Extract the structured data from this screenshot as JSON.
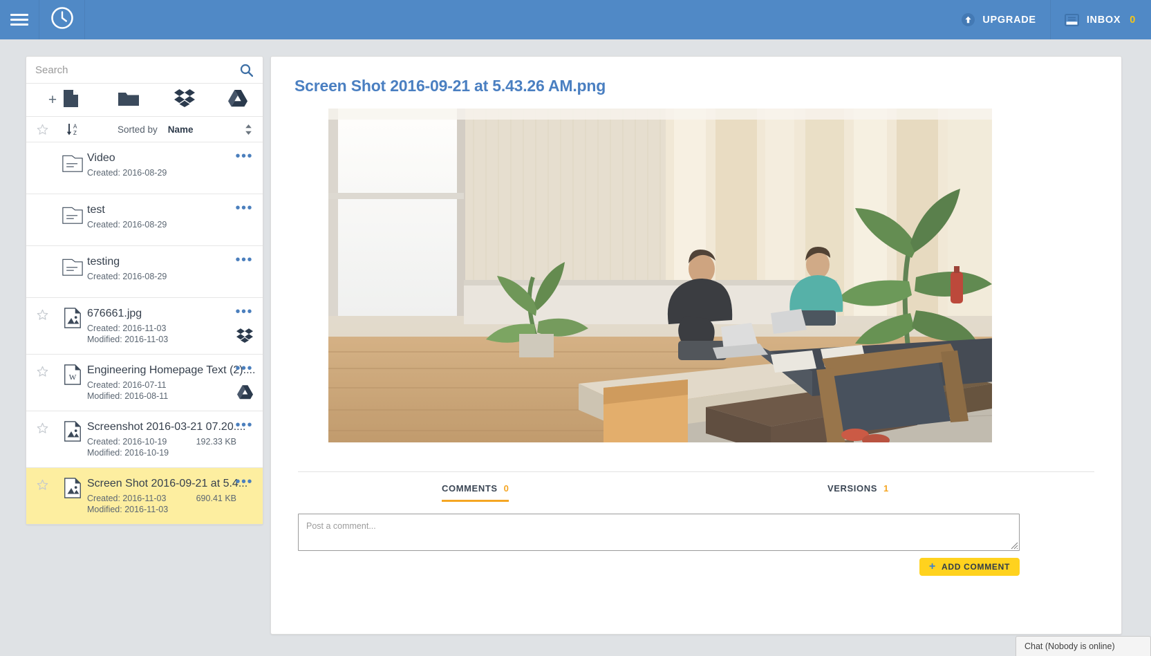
{
  "topbar": {
    "menu_icon": "hamburger-icon",
    "logo_icon": "clock-icon",
    "upgrade_label": "UPGRADE",
    "upgrade_icon": "arrow-up-circle-icon",
    "inbox_label": "INBOX",
    "inbox_icon": "inbox-tray-icon",
    "inbox_count": "0",
    "bg_color": "#5089c6",
    "accent_color": "#f5c518"
  },
  "sidebar": {
    "search": {
      "placeholder": "Search",
      "value": "",
      "icon": "search-icon"
    },
    "tools": [
      {
        "name": "new-file",
        "icon": "plus-document-icon"
      },
      {
        "name": "new-folder",
        "icon": "folder-icon"
      },
      {
        "name": "dropbox",
        "icon": "dropbox-icon"
      },
      {
        "name": "google-drive",
        "icon": "google-drive-icon"
      }
    ],
    "sort": {
      "star_icon": "star-outline-icon",
      "az_icon": "sort-alpha-desc-icon",
      "label": "Sorted by",
      "value": "Name",
      "arrows_icon": "sort-arrows-icon"
    },
    "files": [
      {
        "name": "Video",
        "icon": "folder-document-icon",
        "created": "Created: 2016-08-29",
        "modified": "",
        "size": "",
        "starred": false,
        "has_star": false,
        "cloud": "",
        "selected": false
      },
      {
        "name": "test",
        "icon": "folder-document-icon",
        "created": "Created: 2016-08-29",
        "modified": "",
        "size": "",
        "starred": false,
        "has_star": false,
        "cloud": "",
        "selected": false
      },
      {
        "name": "testing",
        "icon": "folder-document-icon",
        "created": "Created: 2016-08-29",
        "modified": "",
        "size": "",
        "starred": false,
        "has_star": false,
        "cloud": "",
        "selected": false
      },
      {
        "name": "676661.jpg",
        "icon": "image-file-icon",
        "created": "Created: 2016-11-03",
        "modified": "Modified: 2016-11-03",
        "size": "",
        "starred": false,
        "has_star": true,
        "cloud": "dropbox-icon",
        "selected": false
      },
      {
        "name": "Engineering Homepage Text (2)....",
        "icon": "word-file-icon",
        "created": "Created: 2016-07-11",
        "modified": "Modified: 2016-08-11",
        "size": "",
        "starred": false,
        "has_star": true,
        "cloud": "google-drive-icon",
        "selected": false
      },
      {
        "name": "Screenshot 2016-03-21 07.20....",
        "icon": "image-file-icon",
        "created": "Created: 2016-10-19",
        "modified": "Modified: 2016-10-19",
        "size": "192.33 KB",
        "starred": false,
        "has_star": true,
        "cloud": "",
        "selected": false
      },
      {
        "name": "Screen Shot 2016-09-21 at 5.4...",
        "icon": "image-file-icon",
        "created": "Created: 2016-11-03",
        "modified": "Modified: 2016-11-03",
        "size": "690.41 KB",
        "starred": false,
        "has_star": true,
        "cloud": "",
        "selected": true
      }
    ],
    "row_menu_glyph": "•••"
  },
  "main": {
    "title": "Screen Shot 2016-09-21 at 5.43.26 AM.png",
    "preview_alt": "office lounge photo preview",
    "tabs": [
      {
        "label": "COMMENTS",
        "count": "0",
        "active": true
      },
      {
        "label": "VERSIONS",
        "count": "1",
        "active": false
      }
    ],
    "comment": {
      "placeholder": "Post a comment...",
      "value": ""
    },
    "add_comment_label": "ADD COMMENT",
    "add_comment_plus": "+",
    "accent_color": "#ffd21e"
  },
  "chat": {
    "label": "Chat (Nobody is online)"
  }
}
